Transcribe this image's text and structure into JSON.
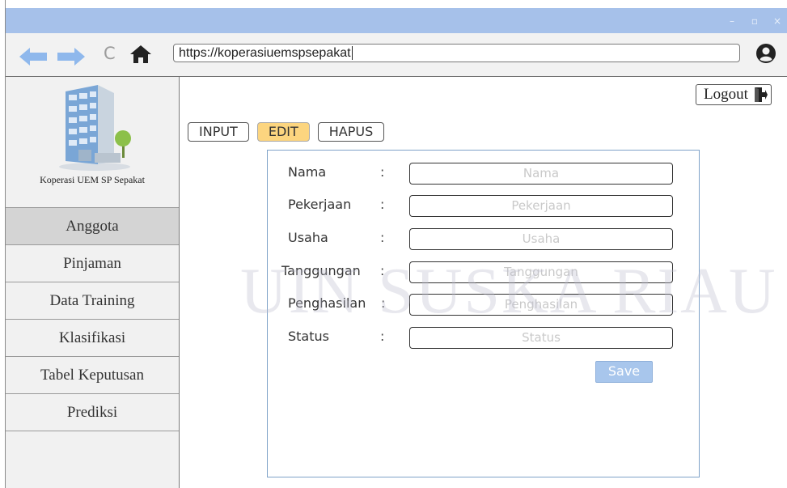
{
  "window": {
    "controls": {
      "minimize": "–",
      "maximize": "▫",
      "close": "×"
    }
  },
  "toolbar": {
    "back_icon": "arrow-left-icon",
    "forward_icon": "arrow-right-icon",
    "reload_icon": "reload-icon",
    "reload_glyph": "C",
    "home_icon": "home-icon",
    "url": "https://koperasiuemspsepakat",
    "account_icon": "user-circle-icon"
  },
  "sidebar": {
    "brand_name": "Koperasi UEM SP Sepakat",
    "items": [
      {
        "label": "Anggota",
        "active": true
      },
      {
        "label": "Pinjaman",
        "active": false
      },
      {
        "label": "Data Training",
        "active": false
      },
      {
        "label": "Klasifikasi",
        "active": false
      },
      {
        "label": "Tabel Keputusan",
        "active": false
      },
      {
        "label": "Prediksi",
        "active": false
      }
    ]
  },
  "header": {
    "logout_label": "Logout",
    "logout_icon": "door-exit-icon"
  },
  "tabs": [
    {
      "label": "INPUT",
      "active": false
    },
    {
      "label": "EDIT",
      "active": true
    },
    {
      "label": "HAPUS",
      "active": false
    }
  ],
  "form": {
    "fields": [
      {
        "label": "Nama",
        "colon": ":",
        "placeholder": "Nama"
      },
      {
        "label": "Pekerjaan",
        "colon": ":",
        "placeholder": "Pekerjaan"
      },
      {
        "label": "Usaha",
        "colon": ":",
        "placeholder": "Usaha"
      },
      {
        "label": "Tanggungan",
        "colon": ":",
        "placeholder": "Tanggungan"
      },
      {
        "label": "Penghasilan",
        "colon": ":",
        "placeholder": "Penghasilan"
      },
      {
        "label": "Status",
        "colon": ":",
        "placeholder": "Status"
      }
    ],
    "save_label": "Save"
  },
  "watermark": "UIN SUSKA RIAU",
  "colors": {
    "titlebar": "#a6c1ea",
    "active_tab": "#fcd57f",
    "active_menu": "#d4d4d4",
    "save_button": "#a8c6ec",
    "nav_arrows": "#8fb8ec"
  }
}
